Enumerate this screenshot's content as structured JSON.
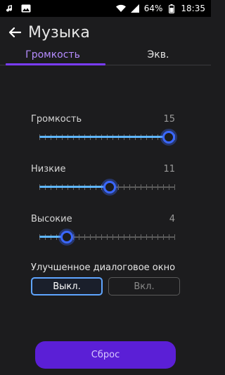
{
  "status_bar": {
    "battery": "64%",
    "time": "18:35",
    "left_icons": [
      "music-note-icon",
      "image-icon"
    ],
    "right_icons": [
      "wifi-icon",
      "signal-icon",
      "battery-icon"
    ]
  },
  "app_bar": {
    "title": "Музыка"
  },
  "tabs": [
    {
      "label": "Громкость",
      "active": true
    },
    {
      "label": "Экв.",
      "active": false
    }
  ],
  "sliders": [
    {
      "label": "Громкость",
      "value": "15",
      "fraction": 1.0
    },
    {
      "label": "Низкие",
      "value": "11",
      "fraction": 0.52
    },
    {
      "label": "Высокие",
      "value": "4",
      "fraction": 0.2
    }
  ],
  "enhanced_dialog": {
    "label": "Улучшенное диалоговое окно",
    "off_label": "Выкл.",
    "on_label": "Вкл.",
    "selected": "off"
  },
  "reset_label": "Сброс",
  "colors": {
    "accent": "#7a3cff",
    "slider": "#5fb6ff",
    "button": "#5b1fd6"
  }
}
